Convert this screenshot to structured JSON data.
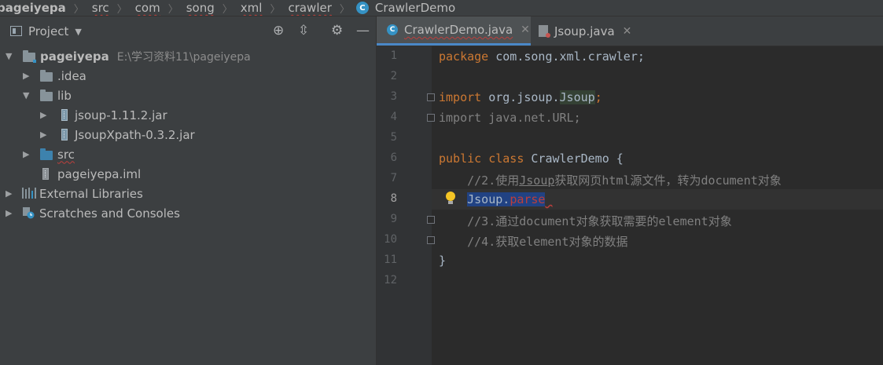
{
  "breadcrumb": {
    "items": [
      "pageiyepa",
      "src",
      "com",
      "song",
      "xml",
      "crawler",
      "CrawlerDemo"
    ]
  },
  "project": {
    "title": "Project",
    "tree": [
      {
        "label": "pageiyepa",
        "path": "E:\\学习资料11\\pageiyepa"
      },
      {
        "label": ".idea"
      },
      {
        "label": "lib"
      },
      {
        "label": "jsoup-1.11.2.jar"
      },
      {
        "label": "JsoupXpath-0.3.2.jar"
      },
      {
        "label": "src"
      },
      {
        "label": "pageiyepa.iml"
      },
      {
        "label": "External Libraries"
      },
      {
        "label": "Scratches and Consoles"
      }
    ]
  },
  "tabs": [
    {
      "label": "CrawlerDemo.java",
      "active": true
    },
    {
      "label": "Jsoup.java",
      "active": false
    }
  ],
  "editor": {
    "line_numbers": [
      "1",
      "2",
      "3",
      "4",
      "5",
      "6",
      "7",
      "8",
      "9",
      "10",
      "11",
      "12"
    ],
    "current_line": "8",
    "lines": {
      "l1_kw": "package",
      "l1_rest": " com.song.xml.crawler;",
      "l3_kw": "import",
      "l3_pkg": " org.jsoup.",
      "l3_cls": "Jsoup",
      "l3_end": ";",
      "l4": "import java.net.URL;",
      "l6_kw": "public class",
      "l6_rest": " CrawlerDemo {",
      "l7_a": "    //2.使用",
      "l7_u": "Jsoup",
      "l7_b": "获取网页html源文件，转为document对象",
      "l8_cls": "Jsoup.",
      "l8_method": "parse",
      "l9": "    //3.通过document对象获取需要的element对象",
      "l10": "    //4.获取element对象的数据",
      "l11": "}"
    }
  },
  "colors": {
    "keyword": "#cc7832",
    "comment": "#808080",
    "selection": "#214283",
    "error": "#bc3f3c",
    "accent": "#4a88c7"
  }
}
